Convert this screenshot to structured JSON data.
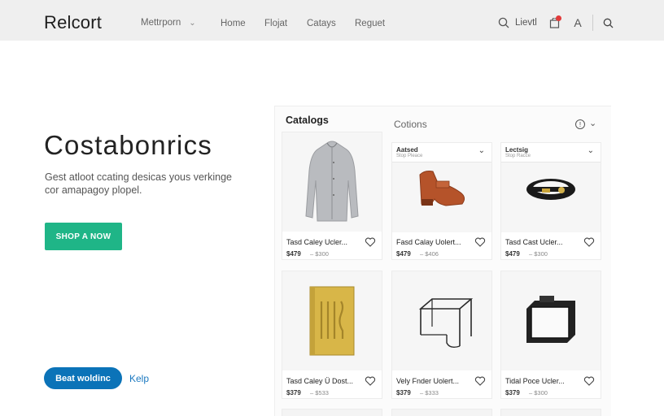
{
  "header": {
    "brand": "Relcort",
    "dropdown_label": "Mettrporn",
    "nav": [
      "Home",
      "Flojat",
      "Catays",
      "Reguet"
    ],
    "account_label": "Lievtl",
    "account_glyph": "A"
  },
  "hero": {
    "title": "Costabonrics",
    "subtitle": "Gest atloot ccating desicas yous verkinge cor amapagoy plopel.",
    "shop_button": "SHOP A NOW",
    "secondary_button": "Beat woldinc",
    "help_link": "Kelp"
  },
  "catalog": {
    "title": "Catalogs",
    "subtitle": "Cotions",
    "products": [
      {
        "name": "Tasd Caley Ucler...",
        "price": "$479",
        "old": "– $300",
        "image": "cardigan",
        "filter": null
      },
      {
        "name": "Fasd Calay Uolert...",
        "price": "$479",
        "old": "– $406",
        "image": "loafer",
        "filter": {
          "label": "Aatsed",
          "sub": "Stop Pleace"
        }
      },
      {
        "name": "Tasd Cast Ucler...",
        "price": "$479",
        "old": "– $300",
        "image": "bracelet",
        "filter": {
          "label": "Lectsig",
          "sub": "Stop Racce"
        }
      },
      {
        "name": "Tasd Caley Ü Dost...",
        "price": "$379",
        "old": "– $533",
        "image": "notebook",
        "filter": null
      },
      {
        "name": "Vely Fnder Uolert...",
        "price": "$379",
        "old": "– $333",
        "image": "wire-cube",
        "filter": null
      },
      {
        "name": "Tidal Poce Ucler...",
        "price": "$379",
        "old": "– $300",
        "image": "camera-box",
        "filter": null
      }
    ]
  },
  "colors": {
    "shop_button": "#1fb587",
    "secondary_button": "#0b73b8",
    "notification_dot": "#e23a3a"
  }
}
